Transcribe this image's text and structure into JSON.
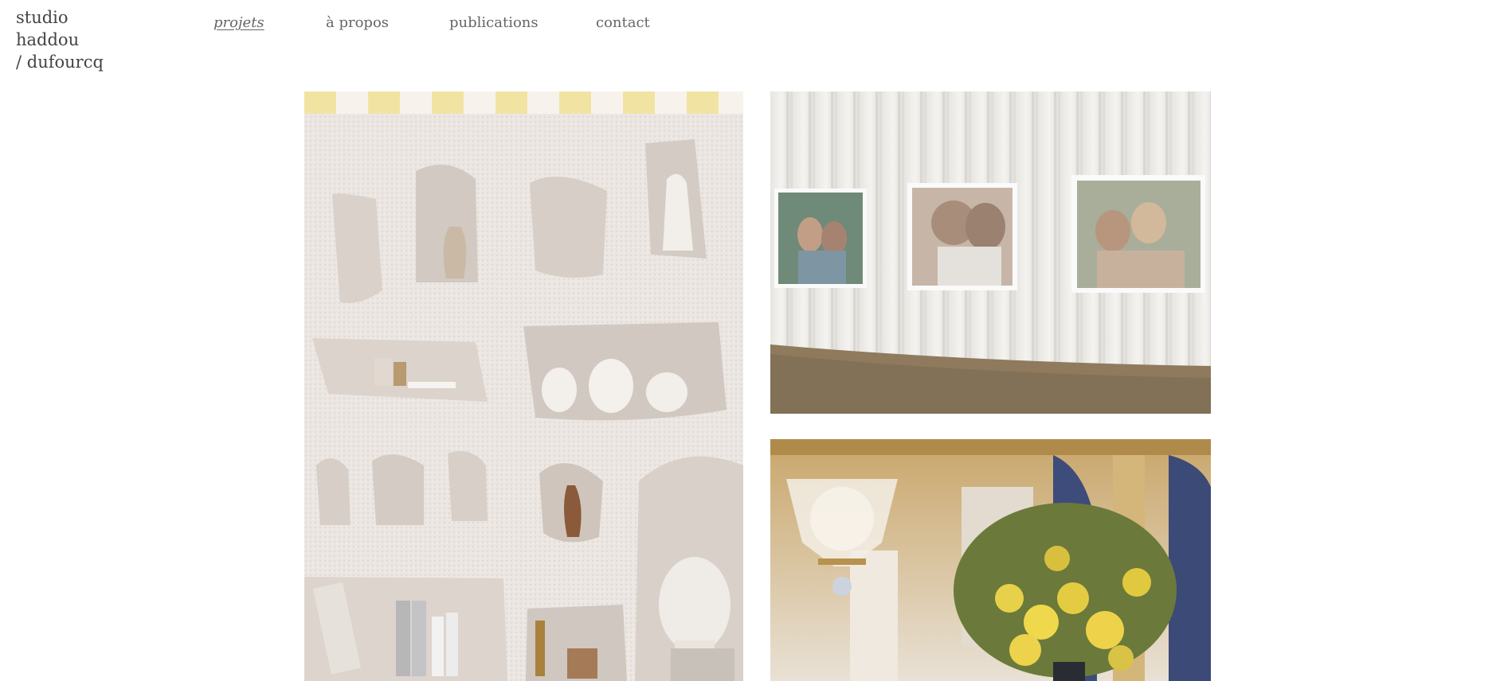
{
  "brand": {
    "lines": [
      "studio",
      "haddou",
      "/ dufourcq"
    ]
  },
  "nav": {
    "items": [
      {
        "label": "projets",
        "active": true
      },
      {
        "label": "à propos",
        "active": false
      },
      {
        "label": "publications",
        "active": false
      },
      {
        "label": "contact",
        "active": false
      }
    ]
  },
  "gallery": {
    "images": [
      {
        "subject": "white textured wall with carved niches holding vases and a classical bust"
      },
      {
        "subject": "framed photographs of women hung on white draped curtain above stone wall"
      },
      {
        "subject": "gilded ornate room with crystal chandelier and yellow mimosa bouquet"
      }
    ]
  },
  "colors": {
    "text": "#555555",
    "background": "#ffffff"
  }
}
